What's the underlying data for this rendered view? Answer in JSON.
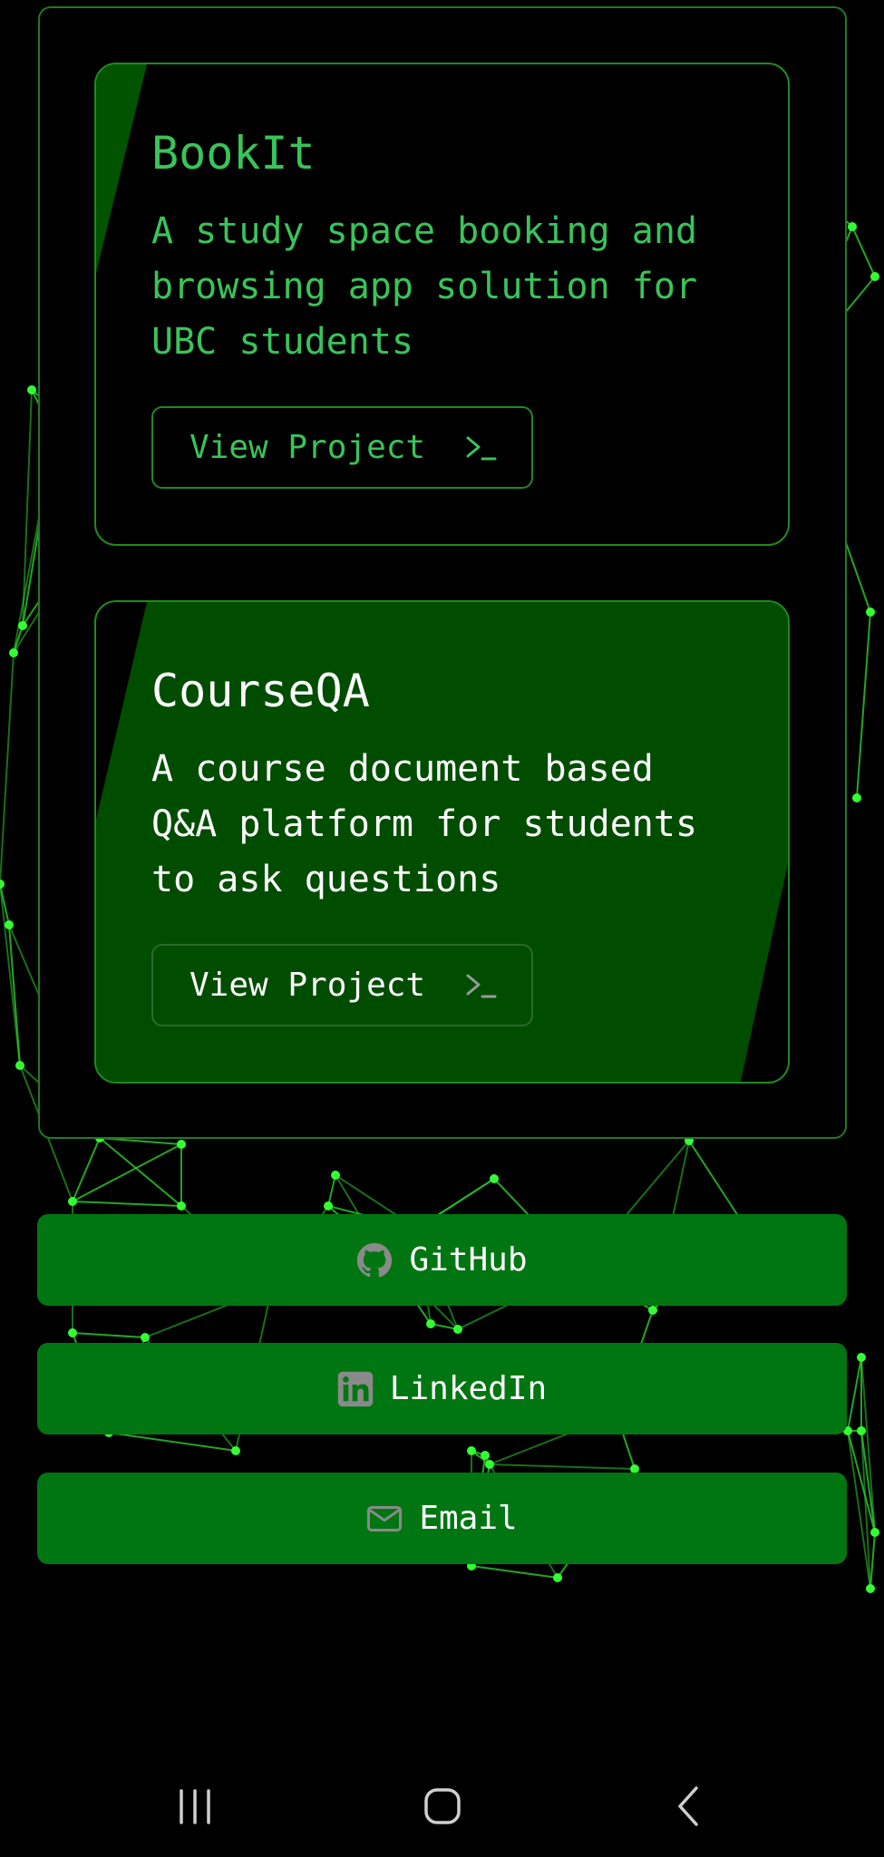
{
  "projects": [
    {
      "title": "BookIt",
      "description": "A study space booking and browsing app solution for UBC students",
      "button_label": "View Project",
      "button_icon": "terminal-prompt-icon"
    },
    {
      "title": "CourseQA",
      "description": "A course document based Q&A platform for students to ask questions",
      "button_label": "View Project",
      "button_icon": "terminal-prompt-icon"
    }
  ],
  "links": {
    "github": {
      "label": "GitHub",
      "icon": "github-icon"
    },
    "linkedin": {
      "label": "LinkedIn",
      "icon": "linkedin-icon"
    },
    "email": {
      "label": "Email",
      "icon": "mail-icon"
    }
  },
  "nav_bar": {
    "recent_icon": "recent-apps-icon",
    "home_icon": "home-icon",
    "back_icon": "back-icon"
  },
  "colors": {
    "background": "#000000",
    "accent_text": "#39c459",
    "card_border": "#1f8a1f",
    "highlight_card": "#004d00",
    "button_green": "#007612",
    "network_green": "#22dd22"
  }
}
